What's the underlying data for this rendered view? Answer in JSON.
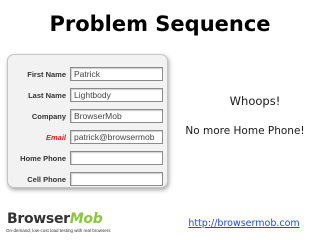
{
  "slide": {
    "title": "Problem Sequence"
  },
  "form": {
    "fields": [
      {
        "label": "First Name",
        "value": "Patrick",
        "error": false
      },
      {
        "label": "Last Name",
        "value": "Lightbody",
        "error": false
      },
      {
        "label": "Company",
        "value": "BrowserMob",
        "error": false
      },
      {
        "label": "Email",
        "value": "patrick@browsermob",
        "error": true
      },
      {
        "label": "Home Phone",
        "value": "",
        "error": false
      },
      {
        "label": "Cell Phone",
        "value": "",
        "error": false
      }
    ]
  },
  "callouts": {
    "whoops": "Whoops!",
    "no_home_phone": "No more Home Phone!"
  },
  "logo": {
    "word_part1": "Browser",
    "word_part2": "Mob",
    "tagline": "On-demand, low-cost load testing with real browsers"
  },
  "link": {
    "url_text": "http://browsermob.com"
  },
  "colors": {
    "error_label": "#e0211b",
    "logo_accent": "#8cc63f",
    "link": "#1a4fd6"
  }
}
